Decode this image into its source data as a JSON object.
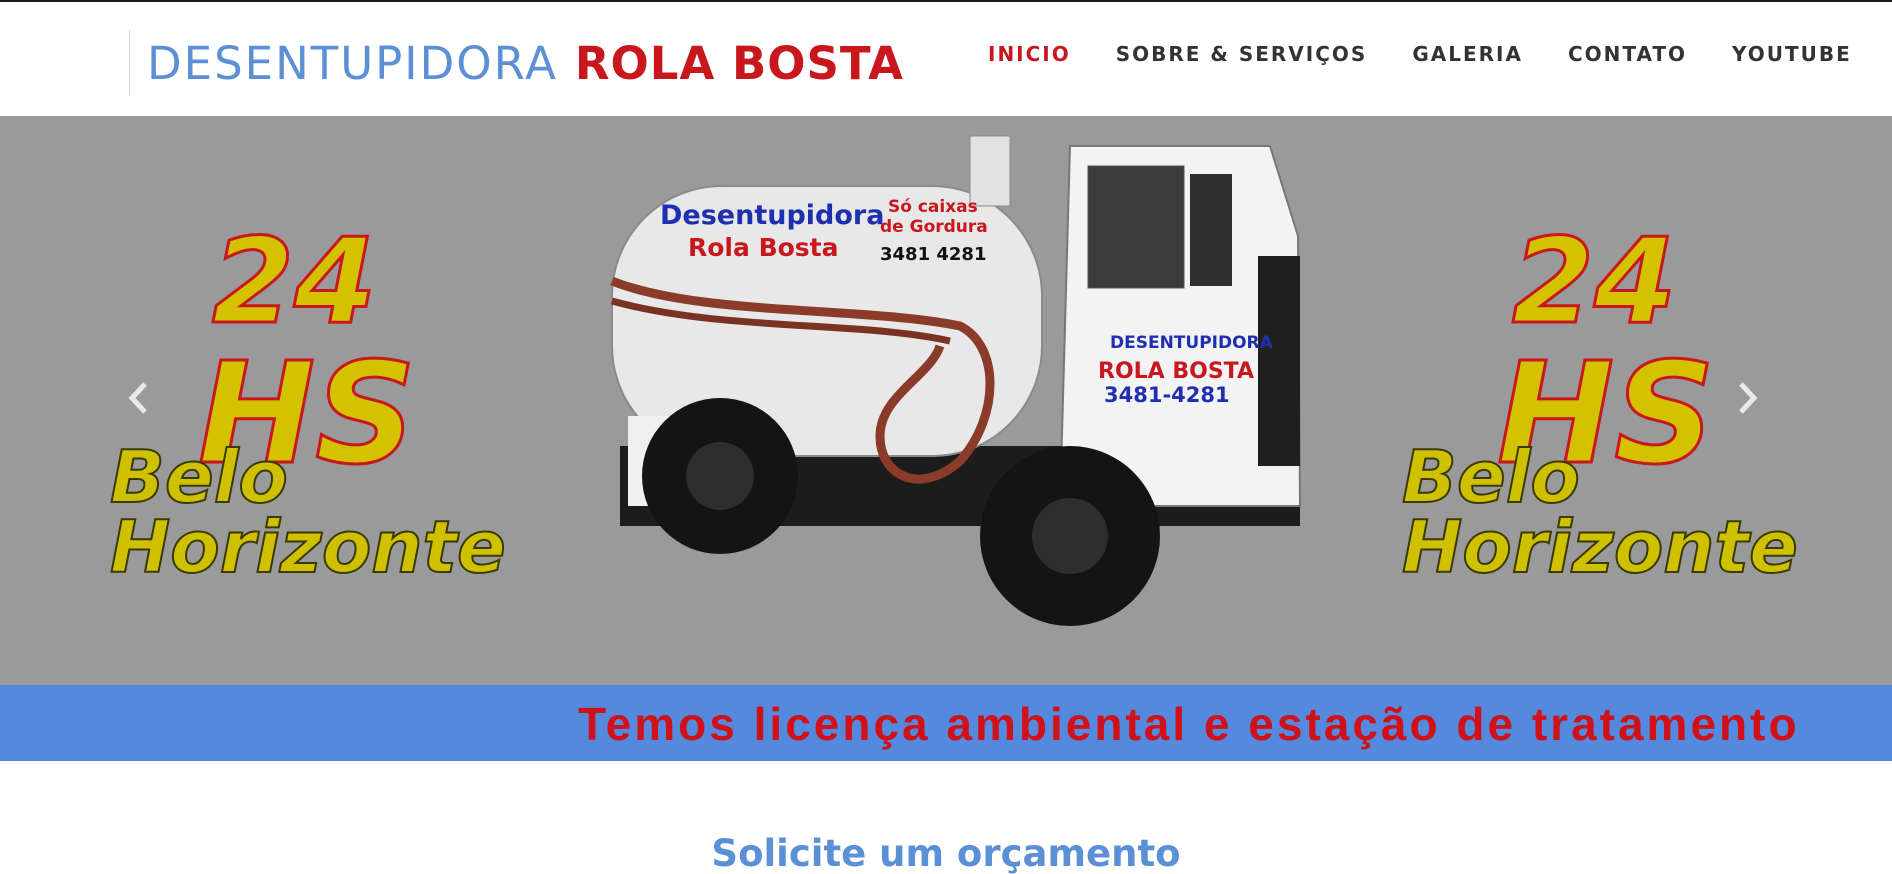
{
  "header": {
    "brand_light": "DESENTUPIDORA",
    "brand_bold": "ROLA BOSTA"
  },
  "nav": {
    "items": [
      {
        "label": "INICIO",
        "active": true
      },
      {
        "label": "SOBRE & SERVIÇOS",
        "active": false
      },
      {
        "label": "GALERIA",
        "active": false
      },
      {
        "label": "CONTATO",
        "active": false
      },
      {
        "label": "YOUTUBE",
        "active": false
      }
    ]
  },
  "hero": {
    "left_badge": {
      "hours_number": "24",
      "hours_unit": "HS",
      "city_line1": "Belo",
      "city_line2": "Horizonte"
    },
    "right_badge": {
      "hours_number": "24",
      "hours_unit": "HS",
      "city_line1": "Belo",
      "city_line2": "Horizonte"
    },
    "truck_tank_line1": "Desentupidora",
    "truck_tank_line2": "Rola Bosta",
    "truck_tank_note1": "Só caixas",
    "truck_tank_note2": "de Gordura",
    "truck_tank_phone": "3481 4281",
    "truck_door_line1": "DESENTUPIDORA",
    "truck_door_line2": "ROLA BOSTA",
    "truck_door_phone": "3481-4281",
    "prev_icon": "chevron-left-icon",
    "next_icon": "chevron-right-icon"
  },
  "ticker": {
    "text": "Temos licença ambiental e estação de tratamento"
  },
  "quote": {
    "title": "Solicite um orçamento"
  },
  "colors": {
    "brand_blue": "#5b8fd6",
    "brand_red": "#c9171e",
    "ticker_bg": "#5489dd",
    "hero_bg": "#9a9a9a"
  }
}
